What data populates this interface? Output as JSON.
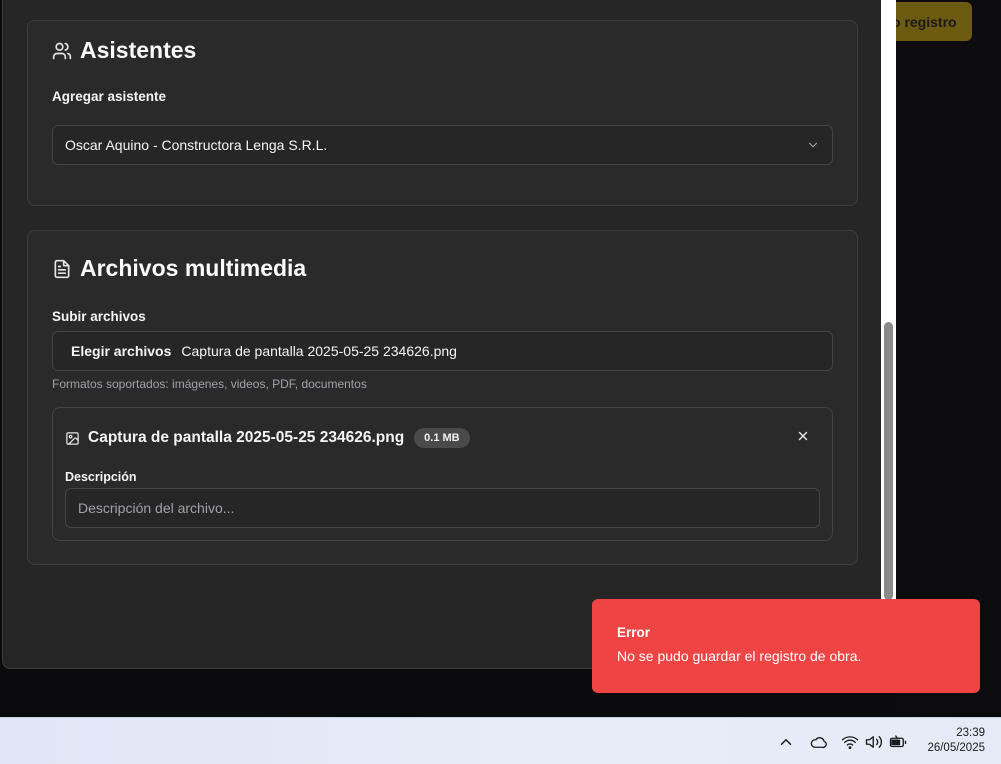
{
  "background": {
    "button_label": "o registro"
  },
  "attendees_card": {
    "title": "Asistentes",
    "add_label": "Agregar asistente",
    "selected_attendee": "Oscar Aquino - Constructora Lenga S.R.L."
  },
  "media_card": {
    "title": "Archivos multimedia",
    "upload_label": "Subir archivos",
    "choose_button": "Elegir archivos",
    "chosen_file": "Captura de pantalla 2025-05-25 234626.png",
    "hint": "Formatos soportados: imágenes, videos, PDF, documentos",
    "file": {
      "name": "Captura de pantalla 2025-05-25 234626.png",
      "size": "0.1 MB",
      "description_label": "Descripción",
      "description_placeholder": "Descripción del archivo..."
    }
  },
  "toast": {
    "title": "Error",
    "message": "No se pudo guardar el registro de obra.",
    "color": "#ef4444"
  },
  "taskbar": {
    "time": "23:39",
    "date": "26/05/2025",
    "tray_icons": [
      "chevron-up-icon",
      "cloud-icon",
      "wifi-icon",
      "volume-icon",
      "battery-icon"
    ]
  }
}
